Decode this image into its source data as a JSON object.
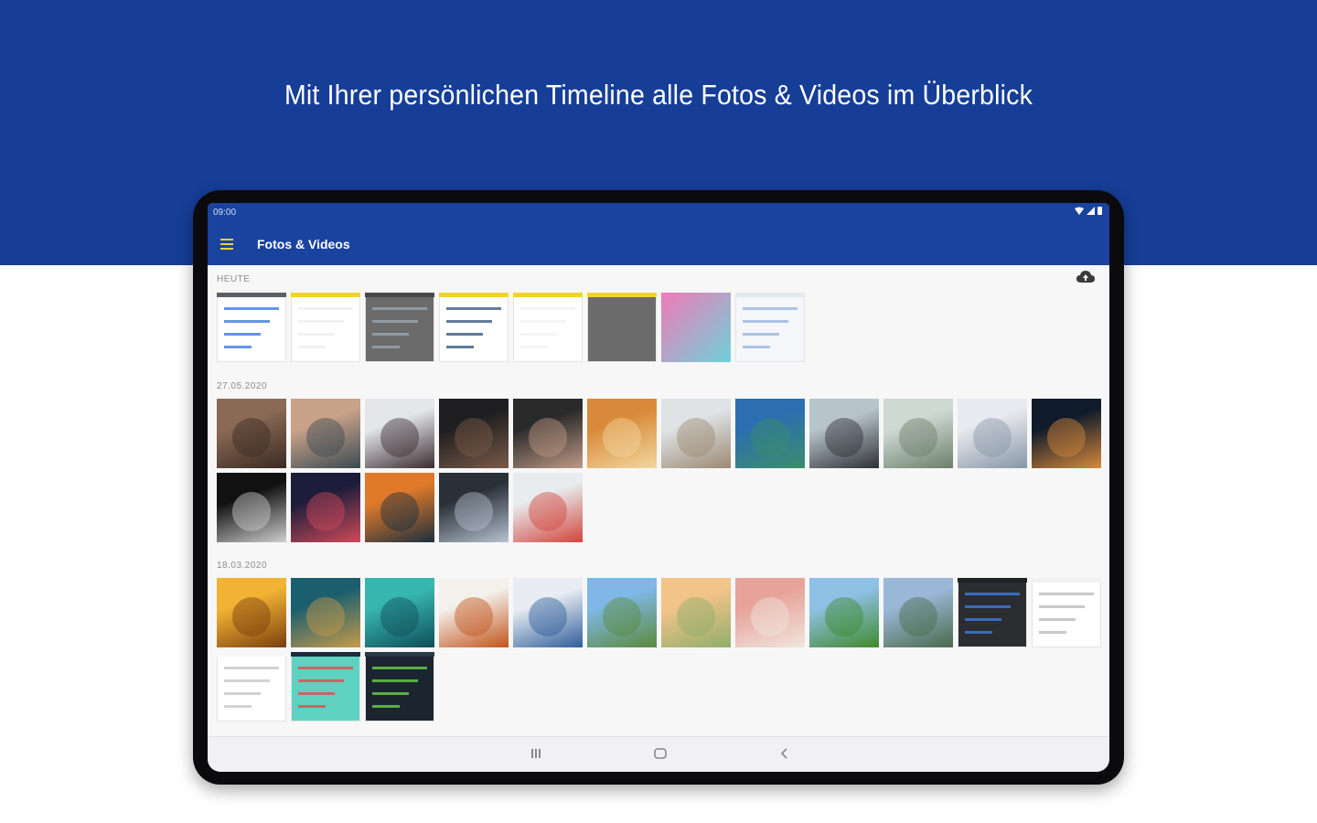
{
  "banner": {
    "headline": "Mit Ihrer persönlichen Timeline alle Fotos & Videos im Überblick",
    "color": "#163e97"
  },
  "status_bar": {
    "time": "09:00",
    "icons": [
      "wifi-icon",
      "signal-icon",
      "battery-icon"
    ]
  },
  "app_bar": {
    "title": "Fotos & Videos",
    "accent": "#e9d23c",
    "color": "#1a43a0"
  },
  "sections": [
    {
      "label": "HEUTE",
      "thumbs": [
        {
          "kind": "screenshot",
          "bg": "#ffffff",
          "top": "#5b5f66",
          "accent": "#3d7be0"
        },
        {
          "kind": "screenshot",
          "bg": "#ffffff",
          "top": "#f3d22f",
          "accent": "#eeeeee"
        },
        {
          "kind": "screenshot",
          "bg": "#6b6b6b",
          "top": "#4a4a4a",
          "accent": "#9aa6b2"
        },
        {
          "kind": "screenshot",
          "bg": "#ffffff",
          "top": "#f3d22f",
          "accent": "#3b5b7f"
        },
        {
          "kind": "screenshot",
          "bg": "#ffffff",
          "top": "#f3d22f",
          "accent": "#f1f1f1"
        },
        {
          "kind": "screenshot",
          "bg": "#6b6b6b",
          "top": "#f3d22f",
          "accent": "#6b6b6b"
        },
        {
          "kind": "gradient",
          "c1": "#f07ab8",
          "c2": "#6fd1d8"
        },
        {
          "kind": "screenshot",
          "bg": "#f4f6fa",
          "top": "#e4e8ef",
          "accent": "#9bb7dd"
        }
      ]
    },
    {
      "label": "27.05.2020",
      "thumbs": [
        {
          "kind": "photo",
          "c1": "#8a6a55",
          "c2": "#3a2a22"
        },
        {
          "kind": "photo",
          "c1": "#c9a28a",
          "c2": "#3b4a52"
        },
        {
          "kind": "photo",
          "c1": "#e4e6ea",
          "c2": "#3a2c30"
        },
        {
          "kind": "photo",
          "c1": "#1e1e20",
          "c2": "#7a5a48"
        },
        {
          "kind": "photo",
          "c1": "#2a2a2a",
          "c2": "#c09a86"
        },
        {
          "kind": "photo",
          "c1": "#d88a3a",
          "c2": "#f3d7a0"
        },
        {
          "kind": "photo",
          "c1": "#dfe3e6",
          "c2": "#9c8a72"
        },
        {
          "kind": "photo",
          "c1": "#2b6fb0",
          "c2": "#3a8e6a"
        },
        {
          "kind": "photo",
          "c1": "#b8c4cc",
          "c2": "#2d3136"
        },
        {
          "kind": "photo",
          "c1": "#cfd9d4",
          "c2": "#6c7f6a"
        },
        {
          "kind": "photo",
          "c1": "#e7eaee",
          "c2": "#8796a6"
        },
        {
          "kind": "photo",
          "c1": "#0f1a2a",
          "c2": "#d88a3c"
        },
        {
          "kind": "photo",
          "c1": "#111111",
          "c2": "#cfcfcf"
        },
        {
          "kind": "photo",
          "c1": "#1b1d3a",
          "c2": "#d04a5a"
        },
        {
          "kind": "photo",
          "c1": "#e07a2a",
          "c2": "#1c2f3e"
        },
        {
          "kind": "photo",
          "c1": "#2a3038",
          "c2": "#b5c2cf"
        },
        {
          "kind": "photo",
          "c1": "#e9ecef",
          "c2": "#d1453b"
        }
      ]
    },
    {
      "label": "18.03.2020",
      "thumbs": [
        {
          "kind": "photo",
          "c1": "#f2b334",
          "c2": "#7a3f0e"
        },
        {
          "kind": "photo",
          "c1": "#1b5f6e",
          "c2": "#c79a4a"
        },
        {
          "kind": "photo",
          "c1": "#37b6b0",
          "c2": "#0f4d57"
        },
        {
          "kind": "photo",
          "c1": "#f4f1ec",
          "c2": "#c2551d"
        },
        {
          "kind": "photo",
          "c1": "#e9edf3",
          "c2": "#2e5e9a"
        },
        {
          "kind": "photo",
          "c1": "#7fb8e6",
          "c2": "#5a8a3a"
        },
        {
          "kind": "photo",
          "c1": "#f3c48a",
          "c2": "#8fae6a"
        },
        {
          "kind": "photo",
          "c1": "#e7a39a",
          "c2": "#f0e6de"
        },
        {
          "kind": "photo",
          "c1": "#8fc0e6",
          "c2": "#3f8a2a"
        },
        {
          "kind": "photo",
          "c1": "#9ab7d7",
          "c2": "#4a6a4a"
        },
        {
          "kind": "screenshot",
          "bg": "#2b2d31",
          "top": "#1f2124",
          "accent": "#3d7be0"
        },
        {
          "kind": "screenshot",
          "bg": "#ffffff",
          "top": "#f1f1f1",
          "accent": "#bcbcbc"
        },
        {
          "kind": "screenshot",
          "bg": "#ffffff",
          "top": "#f7f7f7",
          "accent": "#c7c7c7"
        },
        {
          "kind": "screenshot",
          "bg": "#5fd1c1",
          "top": "#1f2a3a",
          "accent": "#e54b4b"
        },
        {
          "kind": "screenshot",
          "bg": "#1b2530",
          "top": "#2a3b48",
          "accent": "#6bd04a"
        }
      ]
    }
  ],
  "nav_bar": {
    "buttons": [
      "recent-apps-icon",
      "home-icon",
      "back-icon"
    ]
  }
}
